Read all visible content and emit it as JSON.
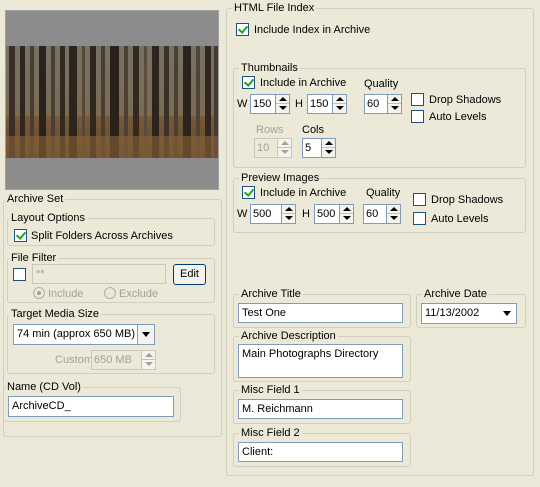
{
  "html_index": {
    "title": "HTML File Index",
    "include_index_label": "Include Index in Archive",
    "include_index_checked": true
  },
  "thumbnails": {
    "title": "Thumbnails",
    "include_label": "Include in Archive",
    "include_checked": true,
    "quality_label": "Quality",
    "w_label": "W",
    "h_label": "H",
    "width": "150",
    "height": "150",
    "quality": "60",
    "drop_shadows_label": "Drop Shadows",
    "auto_levels_label": "Auto Levels",
    "rows_label": "Rows",
    "cols_label": "Cols",
    "rows": "10",
    "cols": "5"
  },
  "preview": {
    "title": "Preview Images",
    "include_label": "Include in Archive",
    "include_checked": true,
    "quality_label": "Quality",
    "w_label": "W",
    "h_label": "H",
    "width": "500",
    "height": "500",
    "quality": "60",
    "drop_shadows_label": "Drop Shadows",
    "auto_levels_label": "Auto Levels"
  },
  "archive_set": {
    "title": "Archive Set",
    "layout_options_title": "Layout Options",
    "split_folders_label": "Split Folders Across Archives",
    "split_folders_checked": true,
    "file_filter_title": "File Filter",
    "file_filter_value": "**",
    "edit_label": "Edit",
    "include_label": "Include",
    "exclude_label": "Exclude",
    "target_media_title": "Target Media Size",
    "target_media_value": "74 min (approx 650 MB)",
    "custom_label": "Custom",
    "custom_value": "650 MB",
    "name_title": "Name (CD Vol)",
    "name_value": "ArchiveCD_"
  },
  "fields": {
    "archive_title_label": "Archive Title",
    "archive_title_value": "Test One",
    "archive_date_label": "Archive Date",
    "archive_date_value": "11/13/2002",
    "archive_description_label": "Archive Description",
    "archive_description_value": "Main Photographs Directory",
    "misc1_label": "Misc Field 1",
    "misc1_value": "M. Reichmann",
    "misc2_label": "Misc Field 2",
    "misc2_value": "Client:"
  }
}
